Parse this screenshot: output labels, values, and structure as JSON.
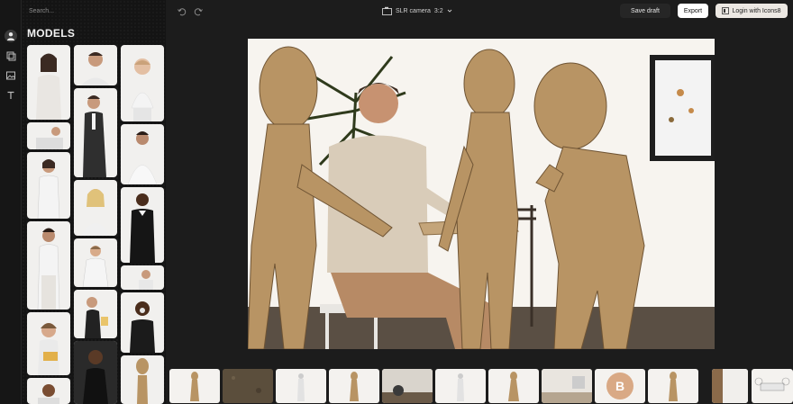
{
  "sidebar": {
    "search_placeholder": "Search...",
    "section_title": "MODELS",
    "nav_icons": [
      "user-icon",
      "layers-icon",
      "image-icon",
      "text-icon"
    ]
  },
  "topbar": {
    "camera_label": "SLR camera",
    "aspect_ratio": "3:2",
    "save_draft_label": "Save draft",
    "export_label": "Export",
    "login_label": "Login with Icons8"
  },
  "colors": {
    "app_bg": "#1c1c1c",
    "panel_bg": "#141414",
    "thumb_bg": "#f1f0ee",
    "alien_skin": "#b89464",
    "canvas_bg": "#f6f3ee"
  },
  "filmstrip": {
    "items": [
      "alien-figure",
      "textured-background",
      "white-figure",
      "alien-figure",
      "indoor-scene",
      "white-figure",
      "alien-figure",
      "room-background",
      "bitcoin-coin",
      "alien-figure",
      "door-scene",
      "drone"
    ],
    "coin_symbol": "B"
  }
}
